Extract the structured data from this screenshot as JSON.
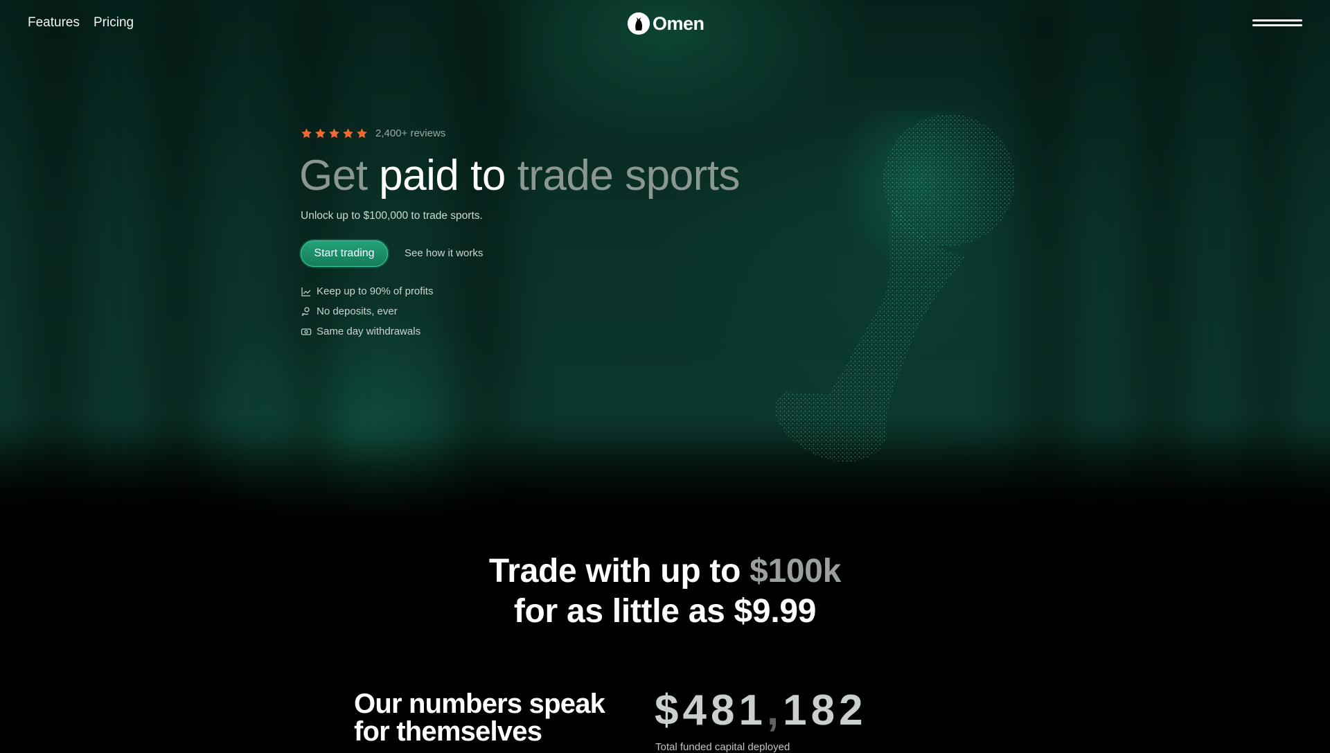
{
  "nav": {
    "links": [
      "Features",
      "Pricing"
    ],
    "logo_text": "Omen"
  },
  "hero": {
    "rating": {
      "stars": 5,
      "reviews_label": "2,400+ reviews",
      "star_color": "#f26a2e"
    },
    "headline": {
      "word1": "Get",
      "word2": "paid to",
      "word3": "trade sports"
    },
    "subhead": "Unlock up to $100,000 to trade sports.",
    "cta_primary": "Start trading",
    "cta_secondary": "See how it works",
    "features": [
      {
        "icon": "chart-up-icon",
        "text": "Keep up to 90% of profits"
      },
      {
        "icon": "hand-coin-icon",
        "text": "No deposits, ever"
      },
      {
        "icon": "cash-icon",
        "text": "Same day withdrawals"
      }
    ],
    "accent_color": "#1f9b74"
  },
  "pricing_tagline": {
    "part1": "Trade with up to ",
    "highlight": "$100k",
    "line2": "for as little as $9.99"
  },
  "stats": {
    "title_line1": "Our numbers speak",
    "title_line2": "for themselves",
    "amount_prefix": "$481",
    "amount_suffix": "182",
    "caption": "Total funded capital deployed"
  }
}
